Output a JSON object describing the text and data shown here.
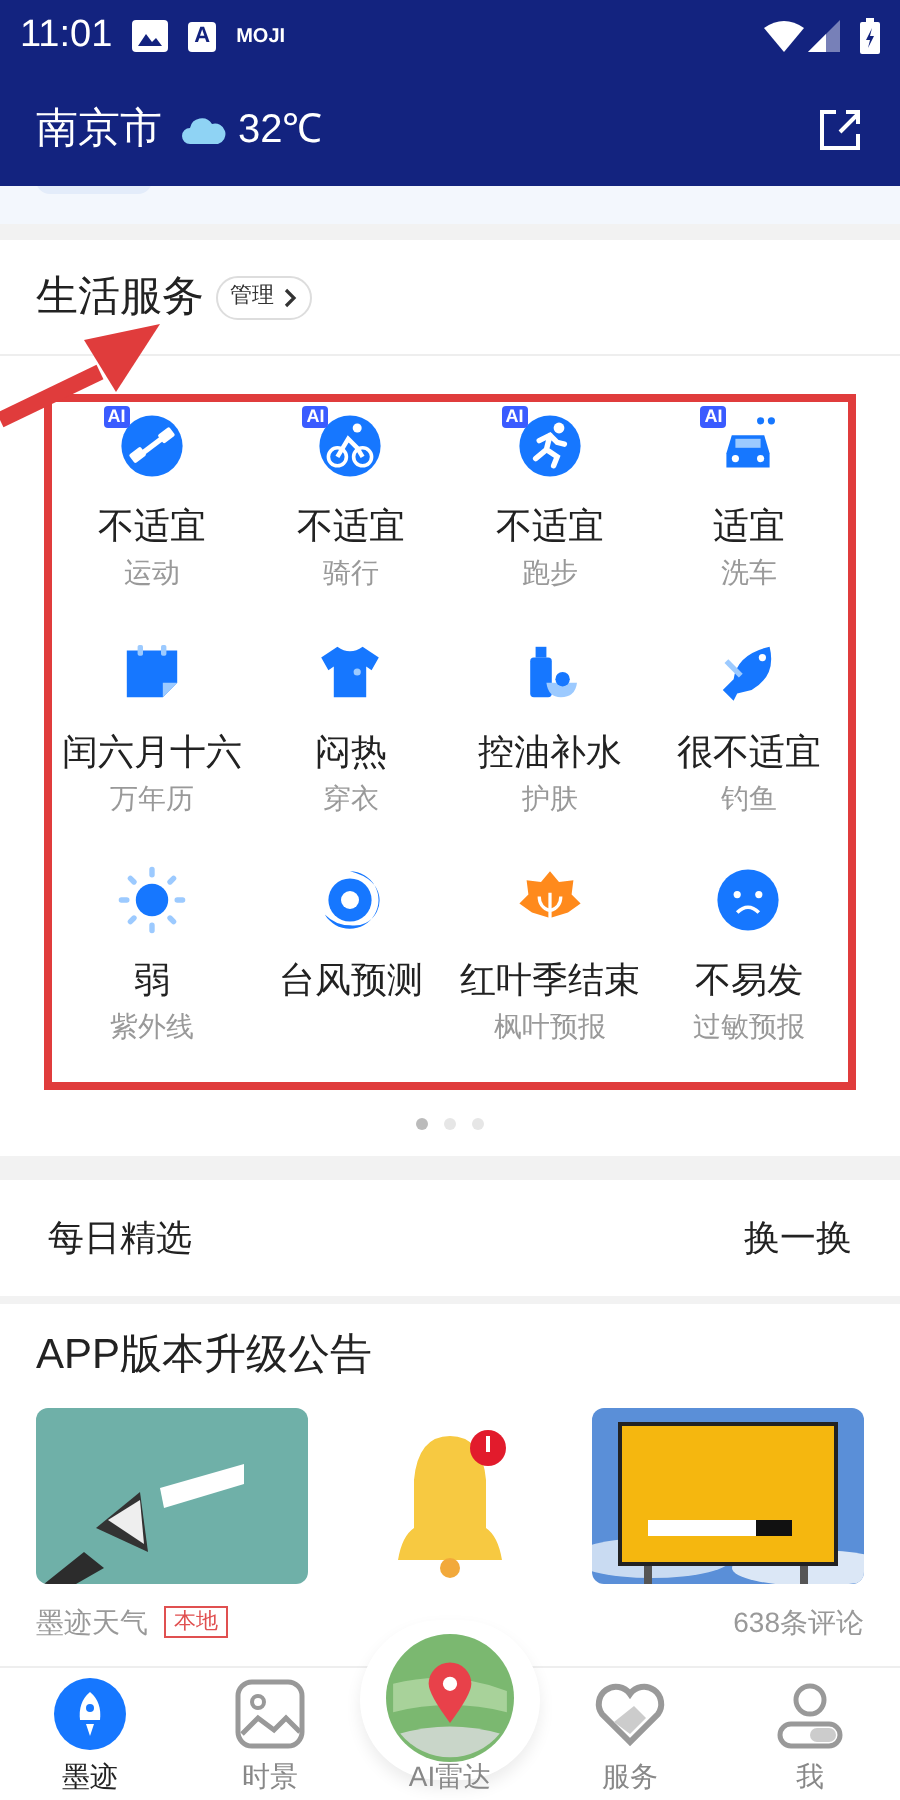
{
  "status_bar": {
    "time": "11:01",
    "app_badges": [
      "A",
      "MOJI"
    ]
  },
  "header": {
    "city": "南京市",
    "temperature": "32℃"
  },
  "life_services": {
    "title": "生活服务",
    "manage_button": "管理",
    "items": [
      {
        "value": "不适宜",
        "label": "运动",
        "badge": "AI"
      },
      {
        "value": "不适宜",
        "label": "骑行",
        "badge": "AI"
      },
      {
        "value": "不适宜",
        "label": "跑步",
        "badge": "AI"
      },
      {
        "value": "适宜",
        "label": "洗车",
        "badge": "AI"
      },
      {
        "value": "闰六月十六",
        "label": "万年历"
      },
      {
        "value": "闷热",
        "label": "穿衣"
      },
      {
        "value": "控油补水",
        "label": "护肤"
      },
      {
        "value": "很不适宜",
        "label": "钓鱼"
      },
      {
        "value": "弱",
        "label": "紫外线"
      },
      {
        "value": "台风预测"
      },
      {
        "value": "红叶季结束",
        "label": "枫叶预报"
      },
      {
        "value": "不易发",
        "label": "过敏预报"
      }
    ],
    "pages": [
      {
        "selected": true
      },
      {
        "selected": false
      },
      {
        "selected": false
      }
    ]
  },
  "daily_picks": {
    "title": "每日精选",
    "refresh": "换一换"
  },
  "article": {
    "title": "APP版本升级公告",
    "source": "墨迹天气",
    "tag": "本地",
    "comments": "638条评论"
  },
  "tab_bar": [
    {
      "label": "墨迹",
      "selected": true
    },
    {
      "label": "时景",
      "selected": false
    },
    {
      "label": "AI雷达",
      "selected": false
    },
    {
      "label": "服务",
      "selected": false
    },
    {
      "label": "我",
      "selected": false
    }
  ]
}
